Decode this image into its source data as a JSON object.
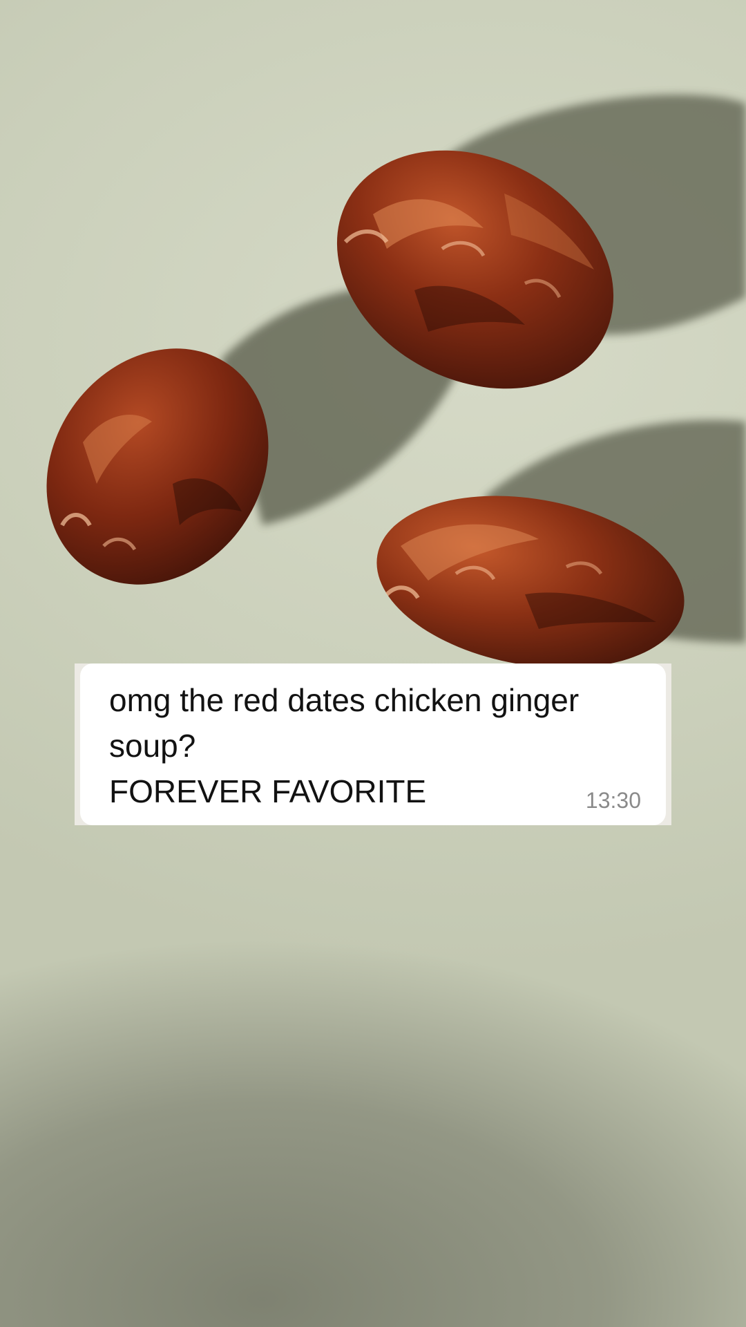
{
  "message": {
    "lines": [
      "omg the red dates chicken ginger",
      "soup?",
      "FOREVER FAVORITE"
    ],
    "timestamp": "13:30"
  },
  "photo": {
    "subject": "three dried red dates on pale green surface",
    "colors": {
      "background": "#cbd0bb",
      "date_fruit": "#7a2a12",
      "shadow": "#5a5c4c"
    }
  }
}
